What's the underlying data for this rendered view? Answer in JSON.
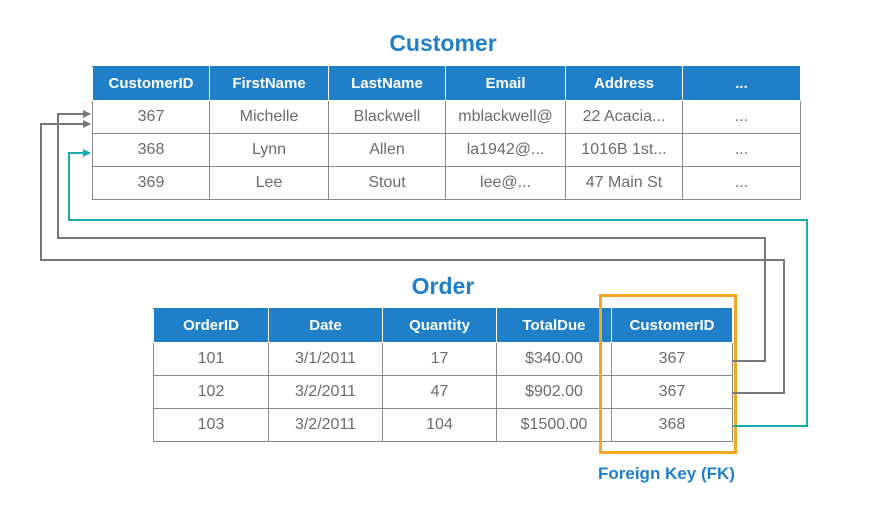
{
  "customer": {
    "title": "Customer",
    "headers": [
      "CustomerID",
      "FirstName",
      "LastName",
      "Email",
      "Address",
      "..."
    ],
    "rows": [
      [
        "367",
        "Michelle",
        "Blackwell",
        "mblackwell@",
        "22 Acacia...",
        "..."
      ],
      [
        "368",
        "Lynn",
        "Allen",
        "la1942@...",
        "1016B 1st...",
        "..."
      ],
      [
        "369",
        "Lee",
        "Stout",
        "lee@...",
        "47 Main St",
        "..."
      ]
    ]
  },
  "order": {
    "title": "Order",
    "headers": [
      "OrderID",
      "Date",
      "Quantity",
      "TotalDue",
      "CustomerID"
    ],
    "rows": [
      [
        "101",
        "3/1/2011",
        "17",
        "$340.00",
        "367"
      ],
      [
        "102",
        "3/2/2011",
        "47",
        "$902.00",
        "367"
      ],
      [
        "103",
        "3/2/2011",
        "104",
        "$1500.00",
        "368"
      ]
    ]
  },
  "foreign_key_label": "Foreign Key (FK)",
  "colors": {
    "header_blue": "#1f7fc9",
    "fk_highlight": "#f5a623",
    "link_gray": "#777777",
    "link_teal": "#1aabb0"
  }
}
